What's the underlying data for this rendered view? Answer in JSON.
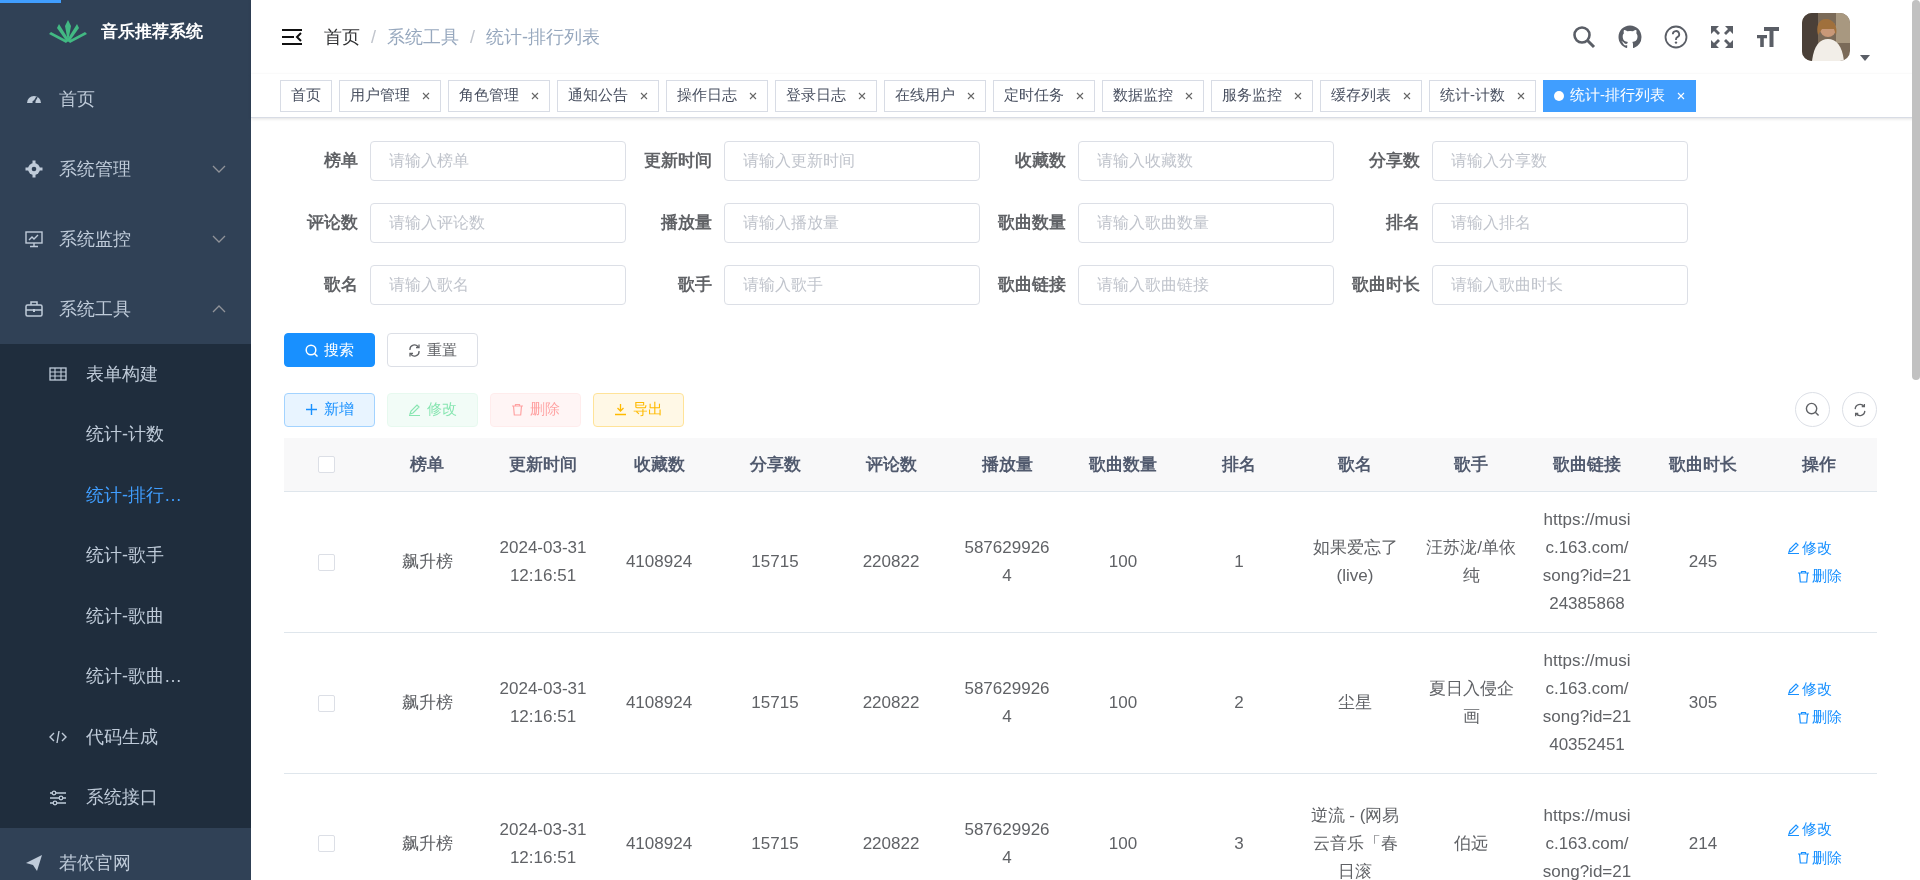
{
  "loading_bar": {
    "level": 0.032
  },
  "sidebar": {
    "title": "音乐推荐系统",
    "items": [
      {
        "label": "首页",
        "selected": false
      },
      {
        "label": "系统管理",
        "expanded": false,
        "selected": false
      },
      {
        "label": "系统监控",
        "expanded": false,
        "selected": false
      },
      {
        "label": "系统工具",
        "expanded": true,
        "selected": false,
        "children": [
          {
            "label": "表单构建",
            "selected": false
          },
          {
            "label": "统计-计数",
            "selected": false
          },
          {
            "label": "统计-排行…",
            "selected": true
          },
          {
            "label": "统计-歌手",
            "selected": false
          },
          {
            "label": "统计-歌曲",
            "selected": false
          },
          {
            "label": "统计-歌曲…",
            "selected": false
          },
          {
            "label": "代码生成",
            "selected": false
          },
          {
            "label": "系统接口",
            "selected": false
          }
        ]
      },
      {
        "label": "若依官网",
        "selected": false
      }
    ]
  },
  "breadcrumb": [
    "首页",
    "系统工具",
    "统计-排行列表"
  ],
  "breadcrumb_separator": "/",
  "tabs": [
    {
      "label": "首页",
      "selected": false,
      "closable": false
    },
    {
      "label": "用户管理",
      "selected": false,
      "closable": true
    },
    {
      "label": "角色管理",
      "selected": false,
      "closable": true
    },
    {
      "label": "通知公告",
      "selected": false,
      "closable": true
    },
    {
      "label": "操作日志",
      "selected": false,
      "closable": true
    },
    {
      "label": "登录日志",
      "selected": false,
      "closable": true
    },
    {
      "label": "在线用户",
      "selected": false,
      "closable": true
    },
    {
      "label": "定时任务",
      "selected": false,
      "closable": true
    },
    {
      "label": "数据监控",
      "selected": false,
      "closable": true
    },
    {
      "label": "服务监控",
      "selected": false,
      "closable": true
    },
    {
      "label": "缓存列表",
      "selected": false,
      "closable": true
    },
    {
      "label": "统计-计数",
      "selected": false,
      "closable": true
    },
    {
      "label": "统计-排行列表",
      "selected": true,
      "closable": true
    }
  ],
  "filters": [
    {
      "label": "榜单",
      "placeholder": "请输入榜单"
    },
    {
      "label": "更新时间",
      "placeholder": "请输入更新时间"
    },
    {
      "label": "收藏数",
      "placeholder": "请输入收藏数"
    },
    {
      "label": "分享数",
      "placeholder": "请输入分享数"
    },
    {
      "label": "评论数",
      "placeholder": "请输入评论数"
    },
    {
      "label": "播放量",
      "placeholder": "请输入播放量"
    },
    {
      "label": "歌曲数量",
      "placeholder": "请输入歌曲数量"
    },
    {
      "label": "排名",
      "placeholder": "请输入排名"
    },
    {
      "label": "歌名",
      "placeholder": "请输入歌名"
    },
    {
      "label": "歌手",
      "placeholder": "请输入歌手"
    },
    {
      "label": "歌曲链接",
      "placeholder": "请输入歌曲链接"
    },
    {
      "label": "歌曲时长",
      "placeholder": "请输入歌曲时长"
    }
  ],
  "search_buttons": [
    {
      "label": "搜索",
      "kind": "primary"
    },
    {
      "label": "重置",
      "kind": "default"
    }
  ],
  "toolbar": [
    {
      "label": "新增",
      "kind": "add",
      "disabled": false
    },
    {
      "label": "修改",
      "kind": "edit",
      "disabled": true
    },
    {
      "label": "删除",
      "kind": "delete",
      "disabled": true
    },
    {
      "label": "导出",
      "kind": "export",
      "disabled": false
    }
  ],
  "table": {
    "header_checked": false,
    "columns": [
      "榜单",
      "更新时间",
      "收藏数",
      "分享数",
      "评论数",
      "播放量",
      "歌曲数量",
      "排名",
      "歌名",
      "歌手",
      "歌曲链接",
      "歌曲时长",
      "操作"
    ],
    "rows": [
      {
        "checked": false,
        "cells": [
          "飙升榜",
          "2024-03-31 12:16:51",
          "4108924",
          "15715",
          "220822",
          "5876299264",
          "100",
          "1",
          "如果爱忘了(live)",
          "汪苏泷/单依纯",
          "https://music.163.com/song?id=2124385868",
          "245"
        ],
        "actions": [
          "修改",
          "删除"
        ]
      },
      {
        "checked": false,
        "cells": [
          "飙升榜",
          "2024-03-31 12:16:51",
          "4108924",
          "15715",
          "220822",
          "5876299264",
          "100",
          "2",
          "尘星",
          "夏日入侵企画",
          "https://music.163.com/song?id=2140352451",
          "305"
        ],
        "actions": [
          "修改",
          "删除"
        ]
      },
      {
        "checked": false,
        "cells": [
          "飙升榜",
          "2024-03-31 12:16:51",
          "4108924",
          "15715",
          "220822",
          "5876299264",
          "100",
          "3",
          "逆流 - (网易云音乐「春日滚",
          "伯远",
          "https://music.163.com/song?id=21",
          "214"
        ],
        "actions": [
          "修改",
          "删除"
        ]
      }
    ]
  }
}
